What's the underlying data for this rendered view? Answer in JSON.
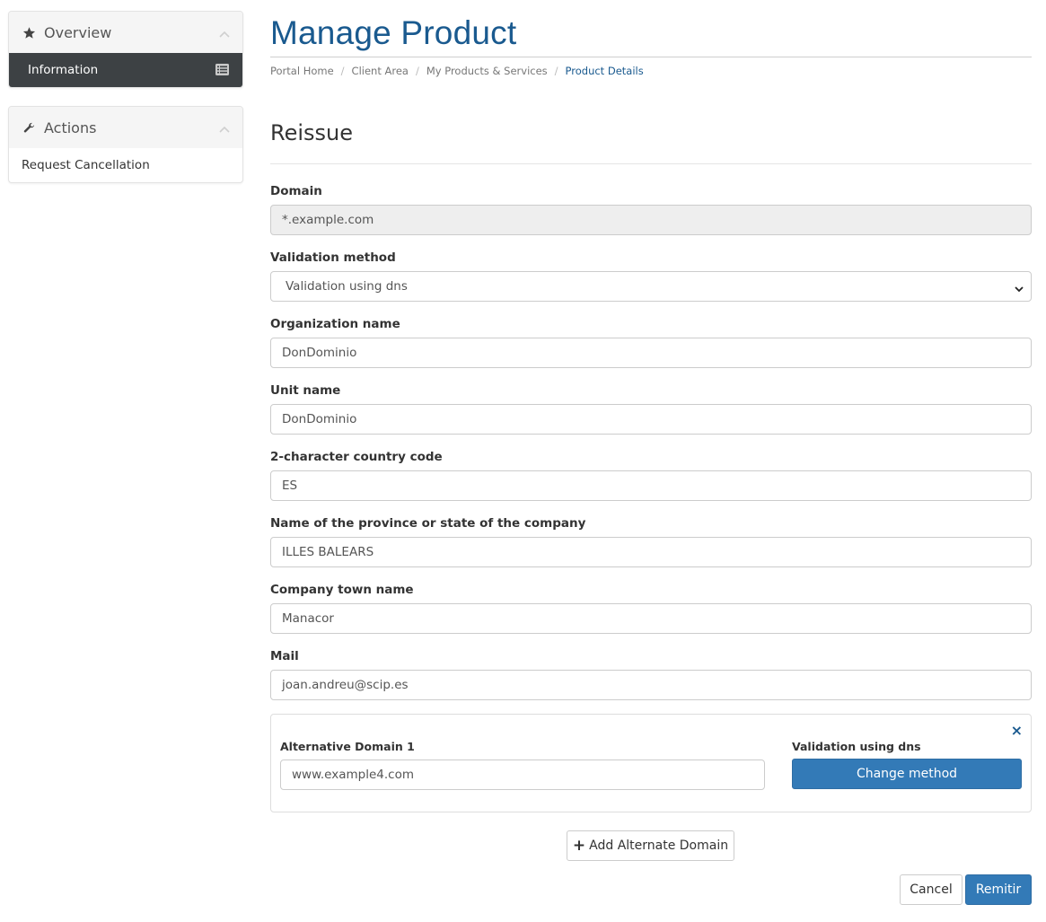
{
  "sidebar": {
    "overview": {
      "title": "Overview",
      "icon": "star-icon",
      "items": [
        {
          "label": "Information",
          "icon": "list-icon"
        }
      ]
    },
    "actions": {
      "title": "Actions",
      "icon": "wrench-icon",
      "items": [
        {
          "label": "Request Cancellation"
        }
      ]
    }
  },
  "header": {
    "title": "Manage Product",
    "breadcrumb": [
      "Portal Home",
      "Client Area",
      "My Products & Services",
      "Product Details"
    ]
  },
  "section": {
    "title": "Reissue"
  },
  "form": {
    "domain": {
      "label": "Domain",
      "value": "*.example.com"
    },
    "validation_method": {
      "label": "Validation method",
      "selected": "Validation using dns"
    },
    "organization_name": {
      "label": "Organization name",
      "value": "DonDominio"
    },
    "unit_name": {
      "label": "Unit name",
      "value": "DonDominio"
    },
    "country_code": {
      "label": "2-character country code",
      "value": "ES"
    },
    "province": {
      "label": "Name of the province or state of the company",
      "value": "ILLES BALEARS"
    },
    "town": {
      "label": "Company town name",
      "value": "Manacor"
    },
    "mail": {
      "label": "Mail",
      "value": "joan.andreu@scip.es"
    }
  },
  "alternative_domain": {
    "label": "Alternative Domain 1",
    "value": "www.example4.com",
    "validation_label": "Validation using dns",
    "change_button": "Change method",
    "remove_symbol": "×"
  },
  "buttons": {
    "add_alternate_domain": "Add Alternate Domain",
    "add_symbol": "+",
    "cancel": "Cancel",
    "submit": "Remitir"
  },
  "colors": {
    "accent": "#337ab7",
    "title": "#1a5a8f",
    "sidebar_active": "#3d4144"
  }
}
